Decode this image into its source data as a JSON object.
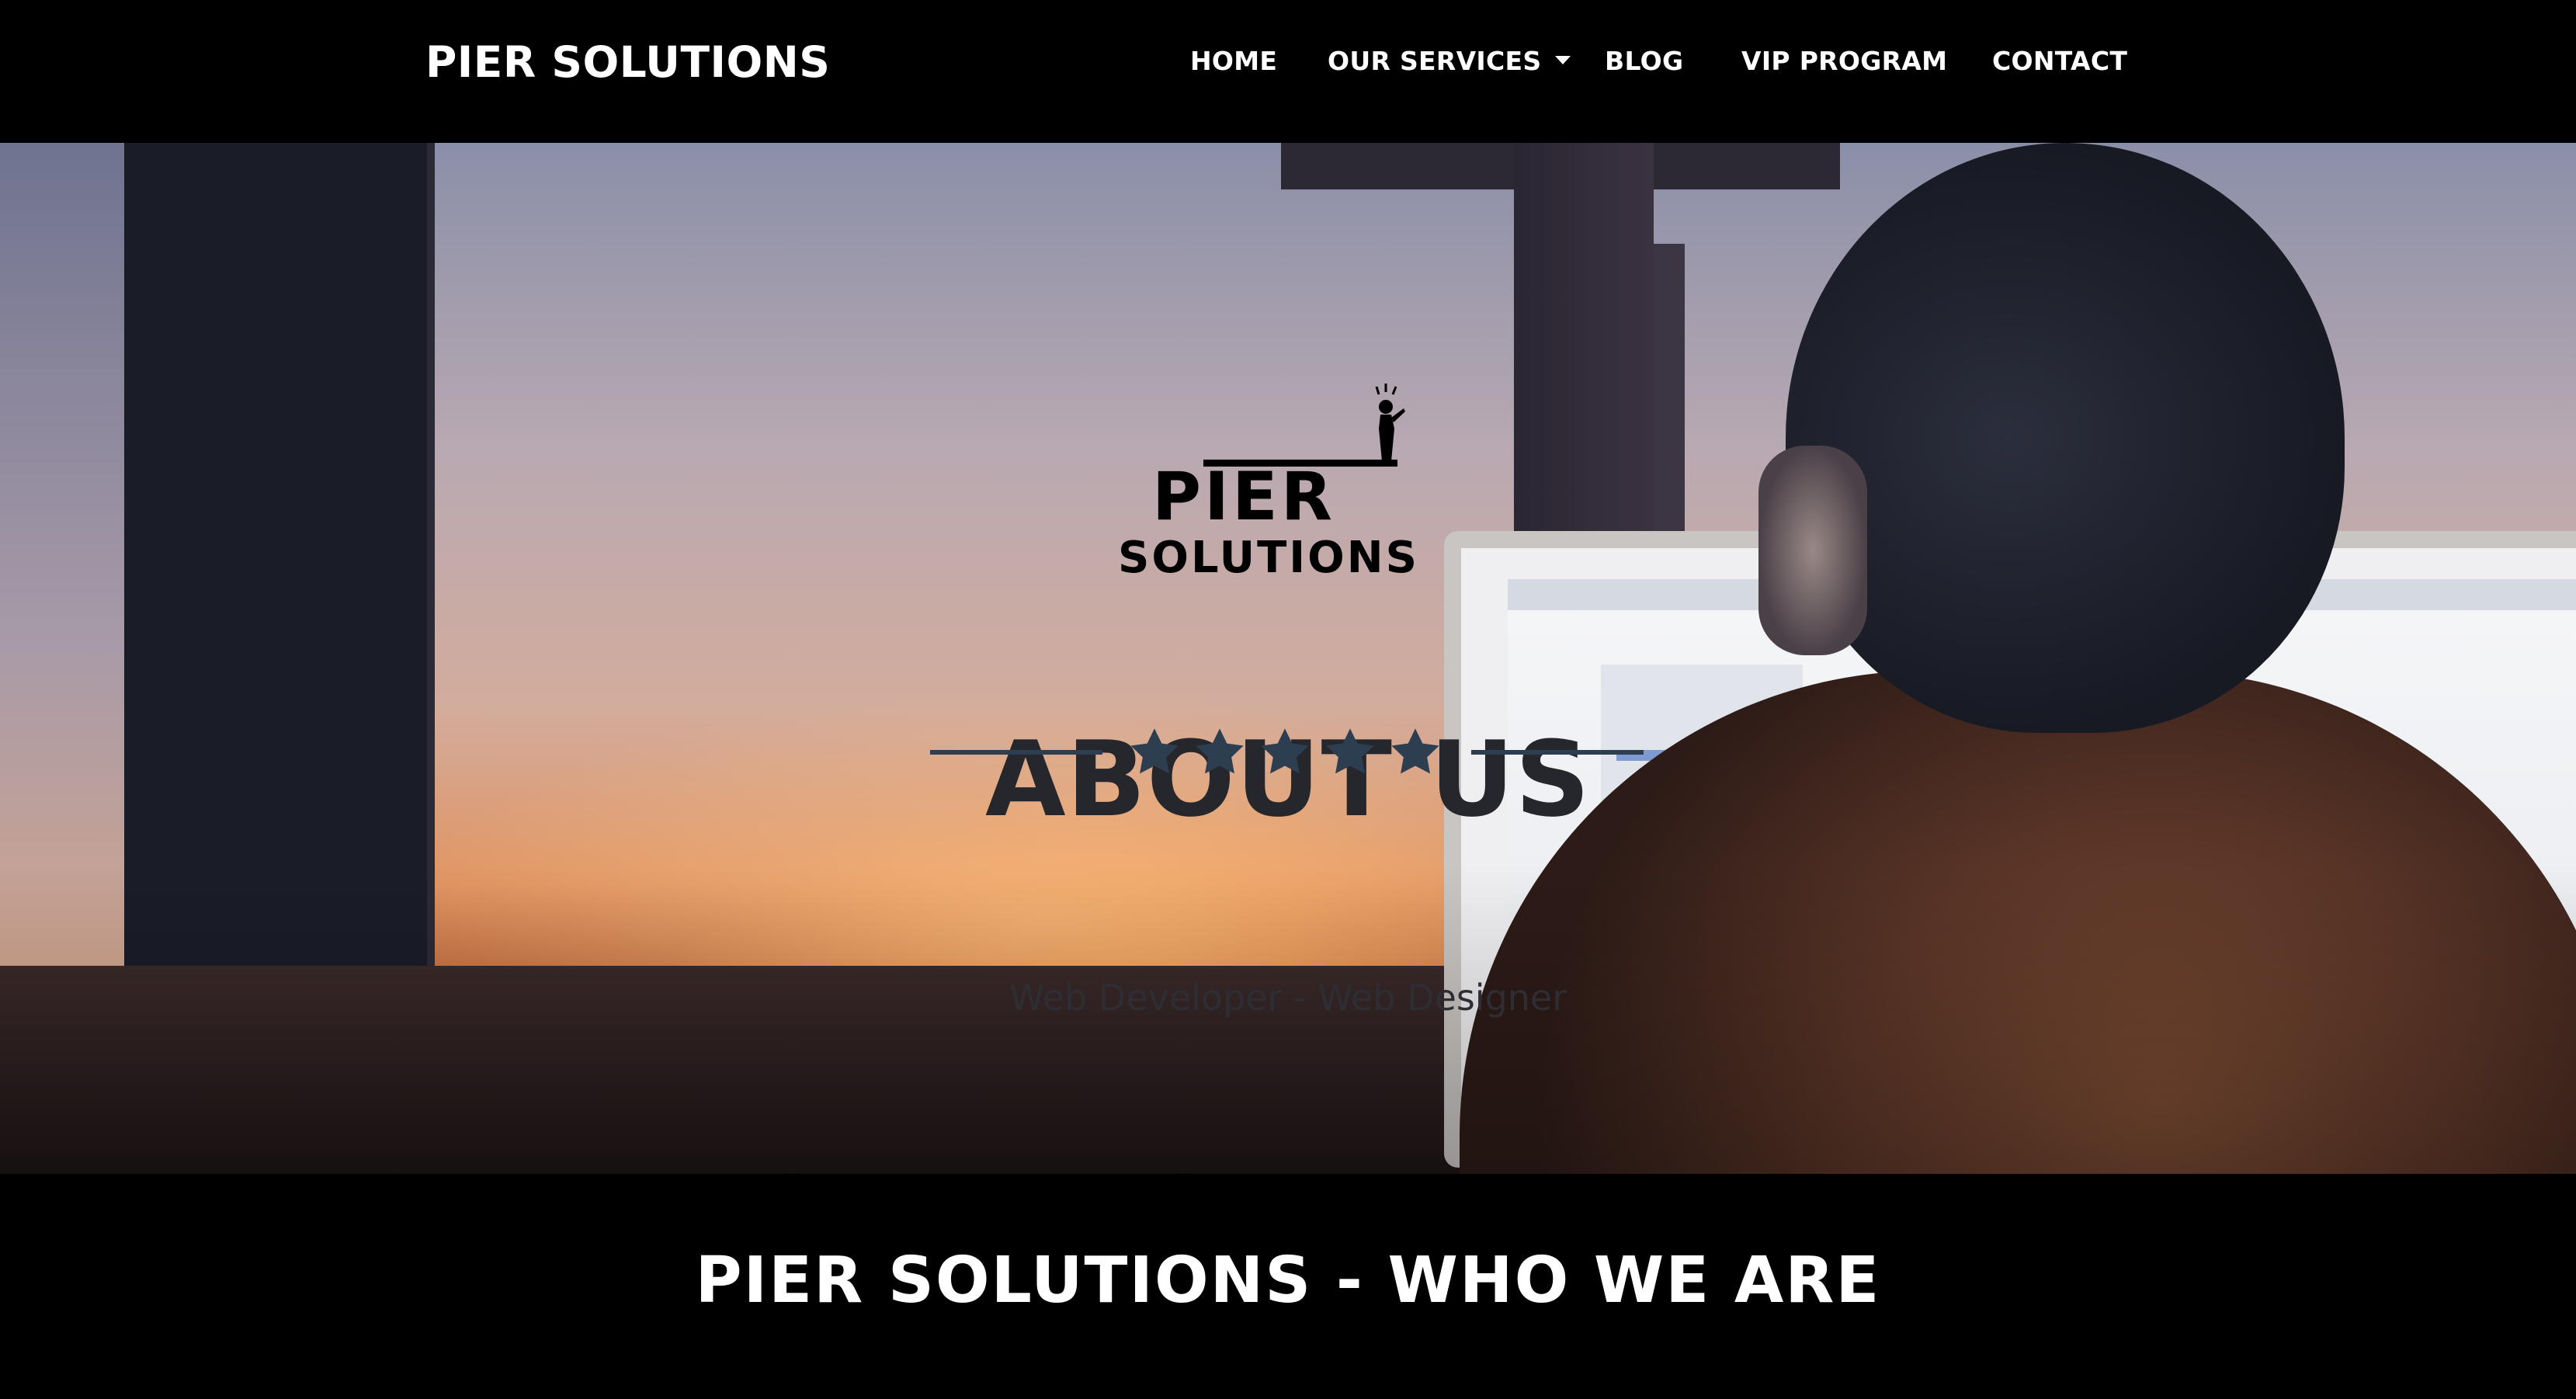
{
  "brand": "PIER SOLUTIONS",
  "nav": {
    "home": "HOME",
    "services": "OUR SERVICES",
    "blog": "BLOG",
    "vip": "VIP PROGRAM",
    "contact": "CONTACT"
  },
  "hero": {
    "logo_line1": "PIER",
    "logo_line2": "SOLUTIONS",
    "title": "ABOUT US",
    "subtitle": "Web Developer - Web Designer",
    "star_rating": 5,
    "star_color": "#2c3e50"
  },
  "section": {
    "title": "PIER SOLUTIONS - WHO WE ARE"
  },
  "colors": {
    "nav_bg": "#000000",
    "accent": "#2c3e50"
  }
}
